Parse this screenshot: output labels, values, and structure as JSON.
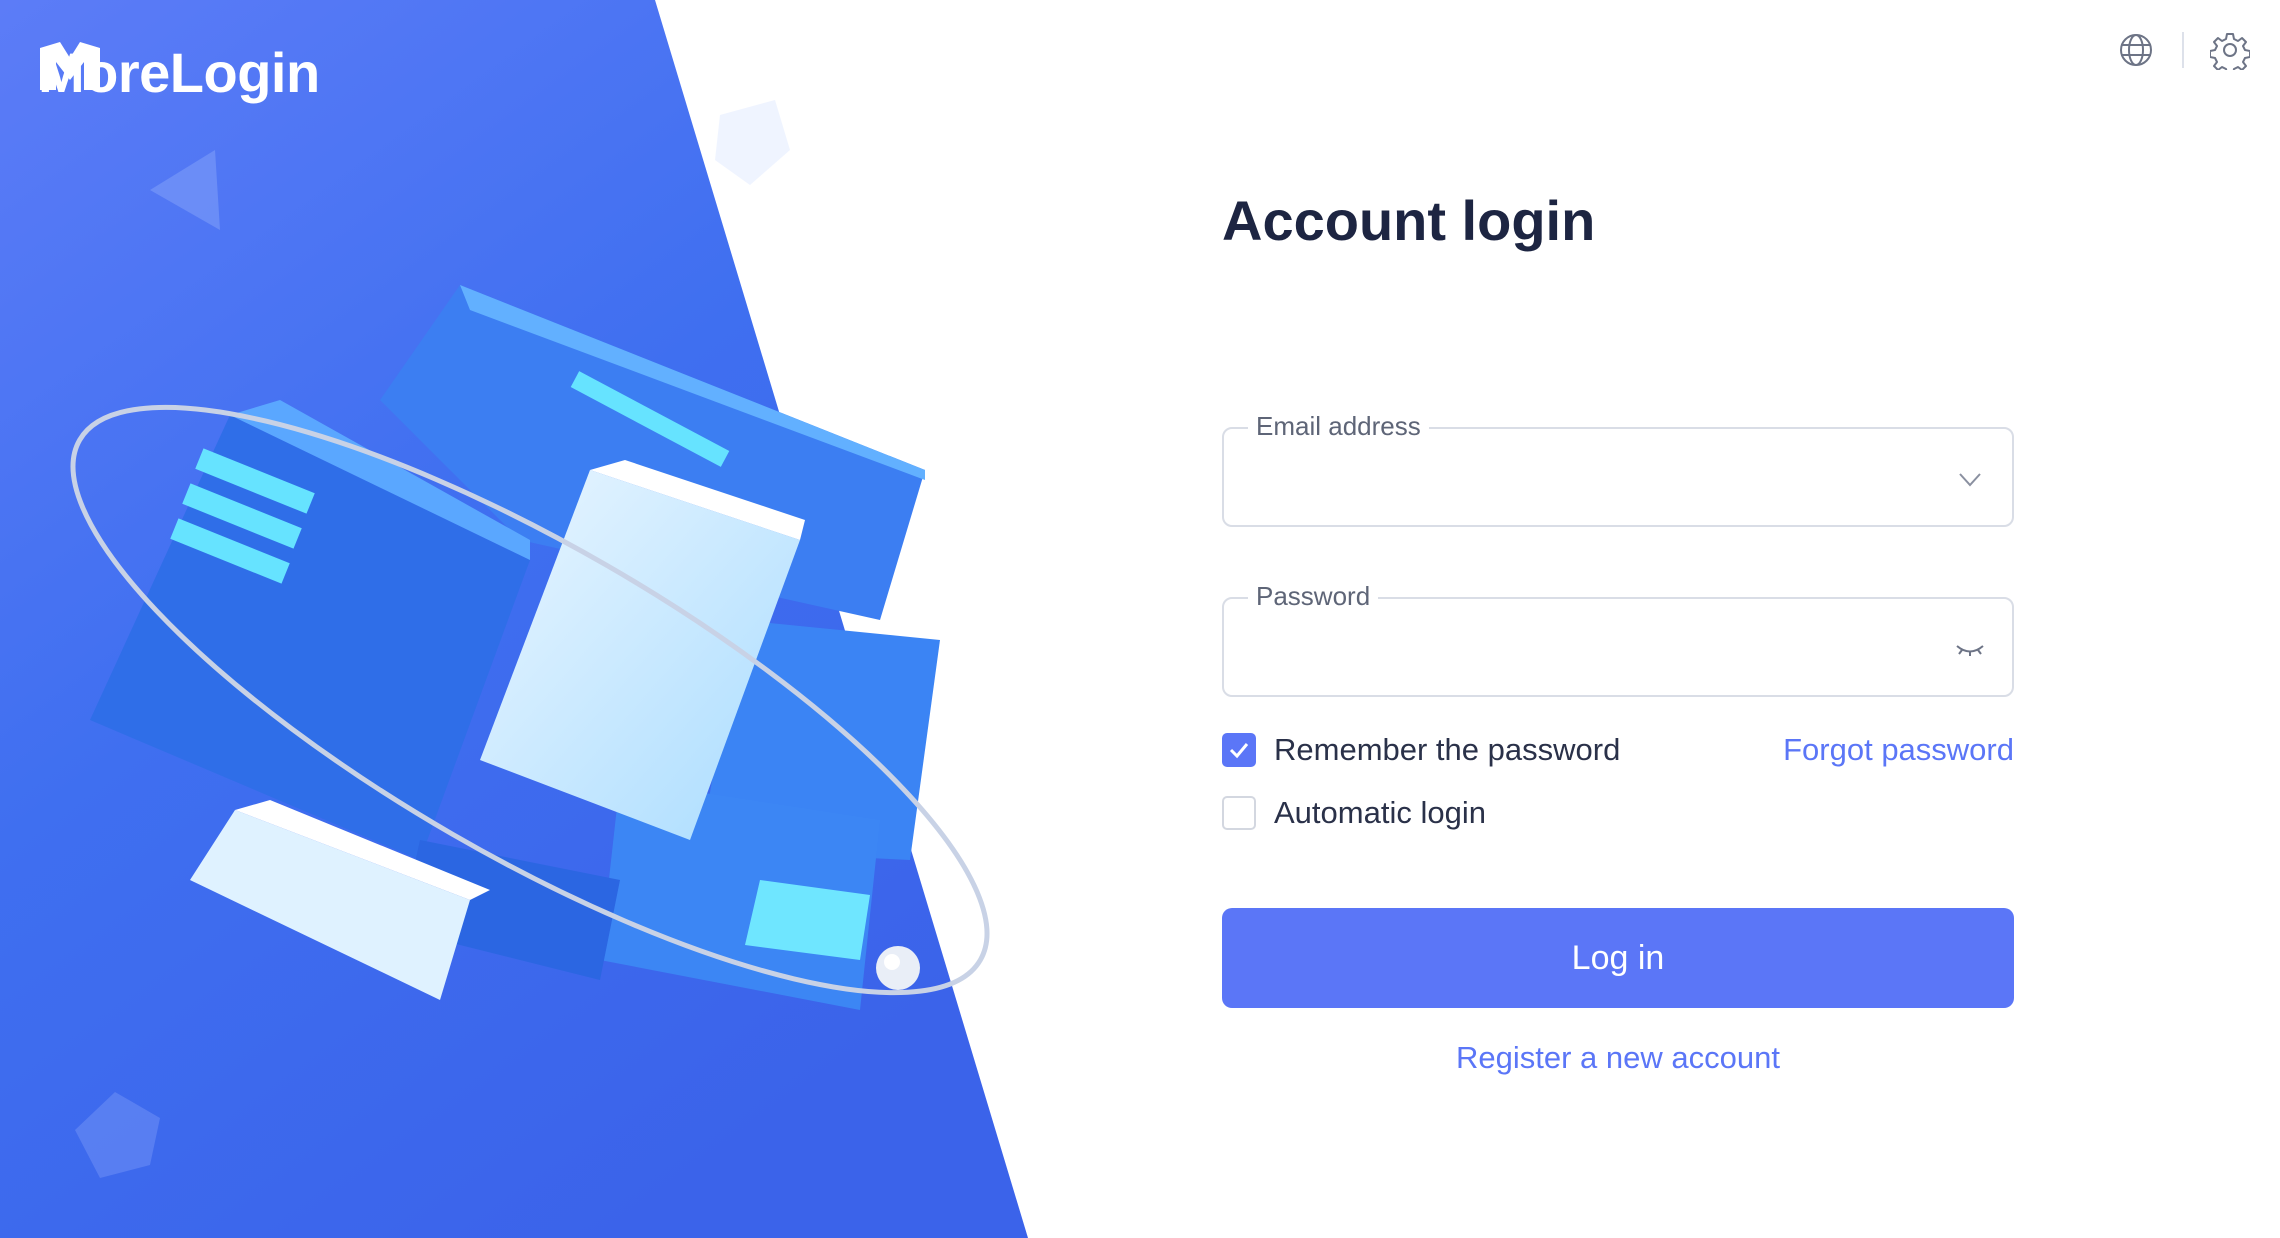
{
  "brand": {
    "name": "MoreLogin"
  },
  "colors": {
    "accent": "#5b76f7",
    "panel_blue": "#4a6cf0",
    "text_dark": "#1d2542"
  },
  "top_bar": {
    "icons": [
      "globe-icon",
      "gear-icon"
    ]
  },
  "login": {
    "title": "Account login",
    "email": {
      "label": "Email address",
      "value": "",
      "placeholder": ""
    },
    "password": {
      "label": "Password",
      "value": "",
      "placeholder": ""
    },
    "remember_password": {
      "label": "Remember the password",
      "checked": true
    },
    "automatic_login": {
      "label": "Automatic login",
      "checked": false
    },
    "forgot_password": "Forgot password",
    "submit": "Log in",
    "register": "Register a new account"
  }
}
